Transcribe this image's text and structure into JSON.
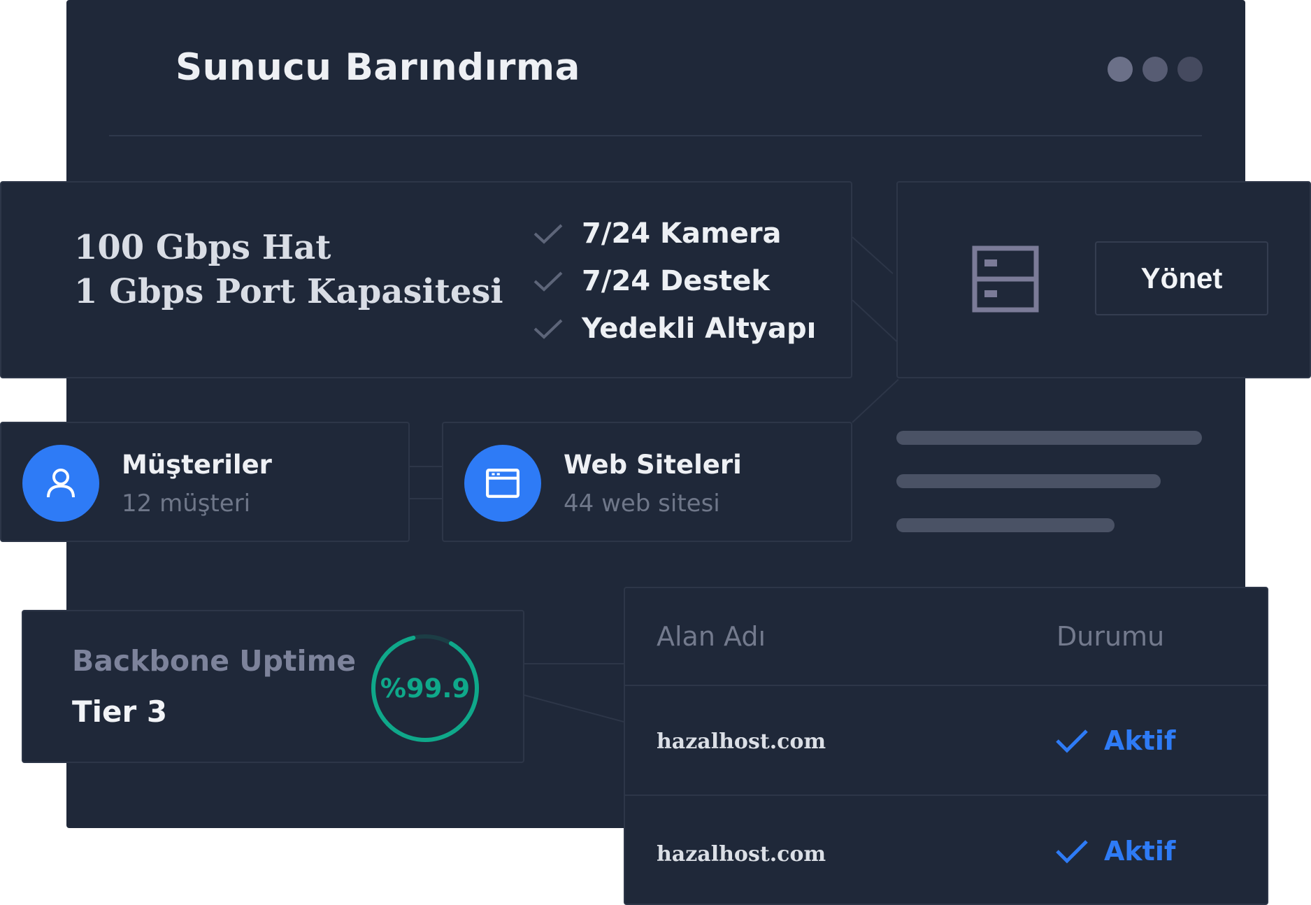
{
  "window": {
    "title": "Sunucu Barındırma",
    "dot_colors": [
      "#6b7088",
      "#575c73",
      "#454a5f"
    ]
  },
  "features_card": {
    "capacity_lines": [
      "100 Gbps Hat",
      "1 Gbps Port Kapasitesi"
    ],
    "features": [
      "7/24 Kamera",
      "7/24 Destek",
      "Yedekli Altyapı"
    ],
    "check_icon": "check-icon"
  },
  "server_card": {
    "icon": "server-icon",
    "manage_label": "Yönet"
  },
  "stats": [
    {
      "title": "Müşteriler",
      "subtitle": "12 müşteri",
      "icon": "user-icon"
    },
    {
      "title": "Web Siteleri",
      "subtitle": "44 web sitesi",
      "icon": "browser-window-icon"
    }
  ],
  "uptime": {
    "title": "Backbone Uptime",
    "tier": "Tier 3",
    "value_label": "%99.9",
    "gauge_fraction": 0.88,
    "gauge_color": "#0fa88a"
  },
  "domain_table": {
    "headers": [
      "Alan Adı",
      "Durumu"
    ],
    "rows": [
      {
        "domain": "hazalhost.com",
        "status": "Aktif"
      },
      {
        "domain": "hazalhost.com",
        "status": "Aktif"
      }
    ],
    "status_color": "#2e7bf6"
  },
  "colors": {
    "panel_bg": "#1f2839",
    "border": "#2d3648",
    "accent_blue": "#2e7bf6",
    "accent_green": "#0fa88a",
    "icon_gray": "#7b7b98"
  }
}
